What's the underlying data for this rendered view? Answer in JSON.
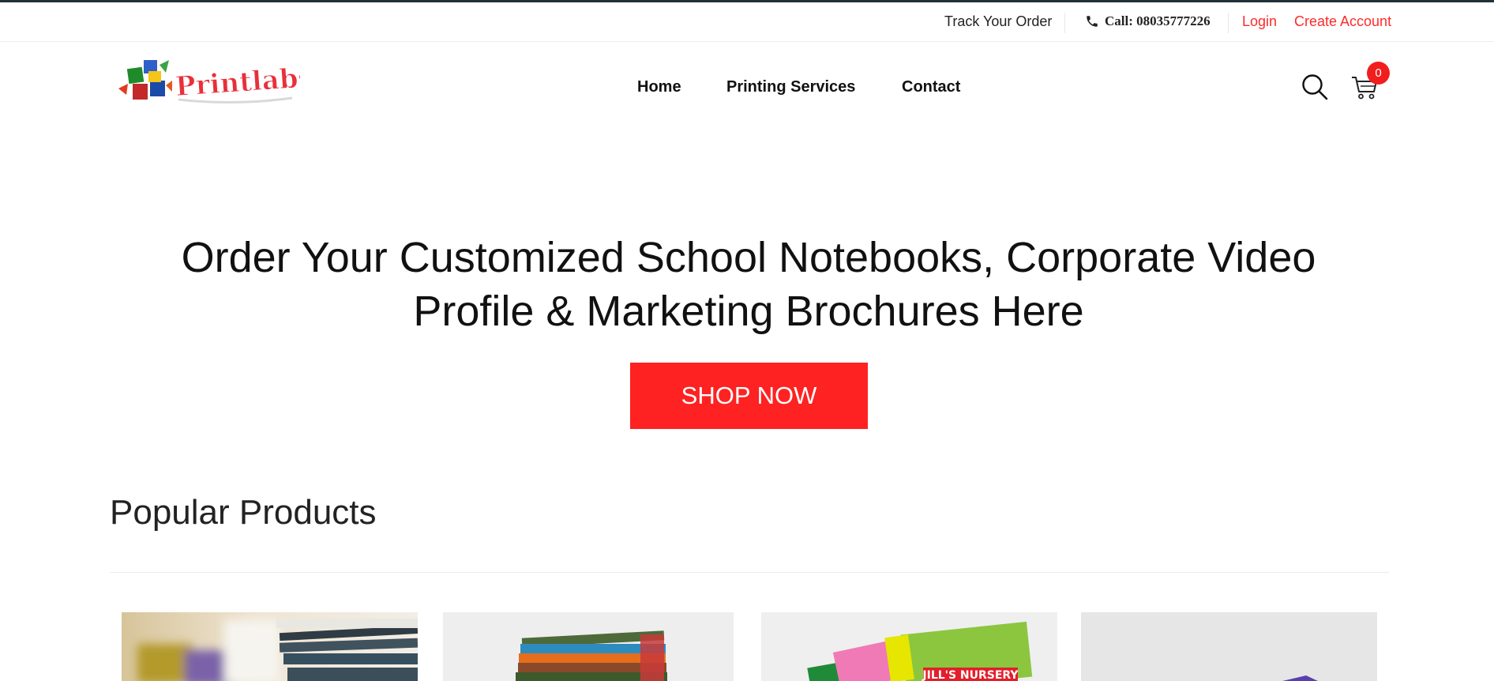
{
  "utility_bar": {
    "track_order": "Track Your Order",
    "call": "Call: 08035777226",
    "login": "Login",
    "create_account": "Create Account"
  },
  "brand": {
    "logo_text": "Printlabs"
  },
  "nav": {
    "items": [
      "Home",
      "Printing Services",
      "Contact"
    ]
  },
  "cart": {
    "count": "0"
  },
  "hero": {
    "title_line1": "Order Your Customized School Notebooks, Corporate Video",
    "title_line2": "Profile & Marketing Brochures Here",
    "cta": "SHOP NOW"
  },
  "popular": {
    "title": "Popular Products",
    "card4_label": "JILL'S NURSERY"
  },
  "colors": {
    "accent": "#fe2222",
    "topline": "#22303a",
    "badge": "#f21d1d"
  }
}
